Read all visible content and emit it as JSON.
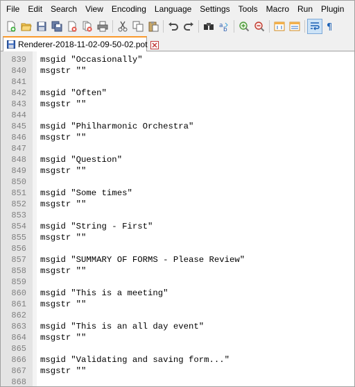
{
  "menu": [
    "File",
    "Edit",
    "Search",
    "View",
    "Encoding",
    "Language",
    "Settings",
    "Tools",
    "Macro",
    "Run",
    "Plugin"
  ],
  "toolbar": {
    "buttons": [
      {
        "icon": "new-file-icon"
      },
      {
        "icon": "open-file-icon"
      },
      {
        "icon": "save-icon"
      },
      {
        "icon": "save-all-icon"
      },
      {
        "icon": "close-icon"
      },
      {
        "icon": "close-all-icon"
      },
      {
        "icon": "print-icon"
      },
      {
        "icon": "cut-icon"
      },
      {
        "icon": "copy-icon"
      },
      {
        "icon": "paste-icon"
      },
      {
        "icon": "undo-icon"
      },
      {
        "icon": "redo-icon"
      },
      {
        "icon": "find-icon"
      },
      {
        "icon": "replace-icon"
      },
      {
        "icon": "zoom-in-icon"
      },
      {
        "icon": "zoom-out-icon"
      },
      {
        "icon": "sync-vertical-icon"
      },
      {
        "icon": "sync-horizontal-icon"
      },
      {
        "icon": "word-wrap-icon"
      },
      {
        "icon": "show-all-characters-icon"
      }
    ]
  },
  "tab": {
    "label": "Renderer-2018-11-02-09-50-02.pot",
    "accent": "#fa9a2c"
  },
  "editor": {
    "lines": [
      {
        "n": "839",
        "text": "msgid \"Occasionally\""
      },
      {
        "n": "840",
        "text": "msgstr \"\""
      },
      {
        "n": "841",
        "text": ""
      },
      {
        "n": "842",
        "text": "msgid \"Often\""
      },
      {
        "n": "843",
        "text": "msgstr \"\""
      },
      {
        "n": "844",
        "text": ""
      },
      {
        "n": "845",
        "text": "msgid \"Philharmonic Orchestra\""
      },
      {
        "n": "846",
        "text": "msgstr \"\""
      },
      {
        "n": "847",
        "text": ""
      },
      {
        "n": "848",
        "text": "msgid \"Question\""
      },
      {
        "n": "849",
        "text": "msgstr \"\""
      },
      {
        "n": "850",
        "text": ""
      },
      {
        "n": "851",
        "text": "msgid \"Some times\""
      },
      {
        "n": "852",
        "text": "msgstr \"\""
      },
      {
        "n": "853",
        "text": ""
      },
      {
        "n": "854",
        "text": "msgid \"String - First\""
      },
      {
        "n": "855",
        "text": "msgstr \"\""
      },
      {
        "n": "856",
        "text": ""
      },
      {
        "n": "857",
        "text": "msgid \"SUMMARY OF FORMS - Please Review\""
      },
      {
        "n": "858",
        "text": "msgstr \"\""
      },
      {
        "n": "859",
        "text": ""
      },
      {
        "n": "860",
        "text": "msgid \"This is a meeting\""
      },
      {
        "n": "861",
        "text": "msgstr \"\""
      },
      {
        "n": "862",
        "text": ""
      },
      {
        "n": "863",
        "text": "msgid \"This is an all day event\""
      },
      {
        "n": "864",
        "text": "msgstr \"\""
      },
      {
        "n": "865",
        "text": ""
      },
      {
        "n": "866",
        "text": "msgid \"Validating and saving form...\""
      },
      {
        "n": "867",
        "text": "msgstr \"\""
      },
      {
        "n": "868",
        "text": ""
      }
    ]
  }
}
